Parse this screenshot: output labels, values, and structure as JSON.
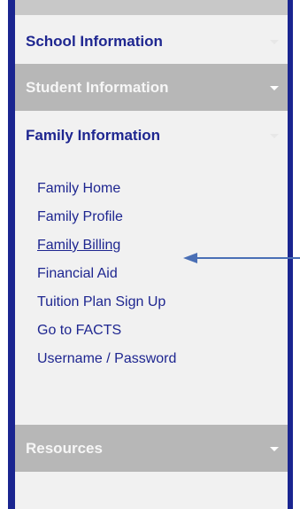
{
  "sections": {
    "school": {
      "label": "School Information",
      "icon": "caret-down-icon"
    },
    "student": {
      "label": "Student Information",
      "icon": "caret-down-icon"
    },
    "family": {
      "label": "Family Information",
      "icon": "caret-down-icon"
    },
    "resources": {
      "label": "Resources",
      "icon": "caret-down-icon"
    }
  },
  "family_items": [
    {
      "label": "Family Home"
    },
    {
      "label": "Family Profile"
    },
    {
      "label": "Family Billing",
      "active": true
    },
    {
      "label": "Financial Aid"
    },
    {
      "label": "Tuition Plan Sign Up"
    },
    {
      "label": "Go to FACTS"
    },
    {
      "label": "Username / Password"
    }
  ],
  "annotation": {
    "icon": "left-arrow-icon",
    "points_to": "Family Billing"
  },
  "colors": {
    "nav_border": "#1a2590",
    "link_text": "#1e2690",
    "collapsed_header_bg": "#b7b7b7",
    "panel_bg": "#f1f1f1",
    "annotation_arrow": "#4a6fb5"
  }
}
